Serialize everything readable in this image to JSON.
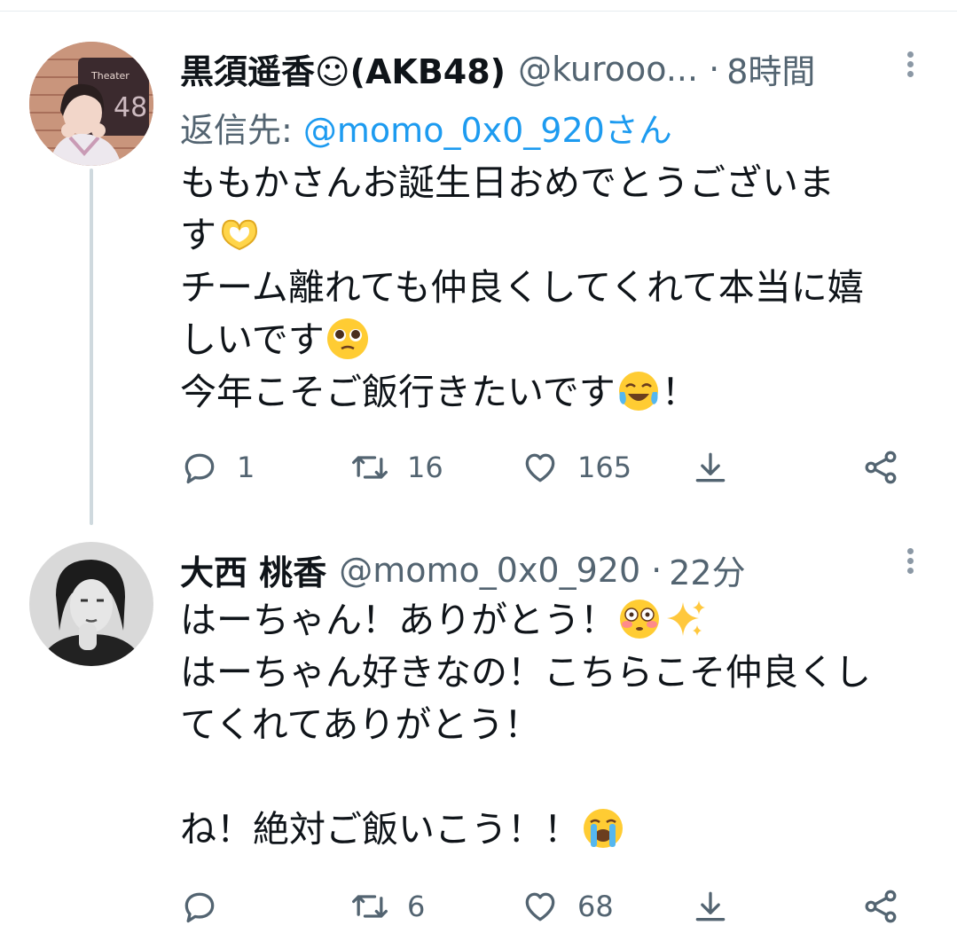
{
  "tweets": [
    {
      "name": "黒須遥香☺(AKB48)",
      "handle": "@kurooo...",
      "separator": "·",
      "time": "8時間",
      "reply_label": "返信先:",
      "reply_to": "@momo_0x0_920さん",
      "lines": [
        "ももかさんお誕生日おめでとうございま",
        "す",
        "チーム離れても仲良くしてくれて本当に嬉",
        "しいです",
        "今年こそご飯行きたいです",
        "！"
      ],
      "emoji": [
        "heart-hands-emoji",
        "pleading-face-emoji",
        "tears-of-joy-emoji"
      ],
      "counts": {
        "replies": "1",
        "retweets": "16",
        "likes": "165"
      }
    },
    {
      "name": "大西 桃香",
      "handle": "@momo_0x0_920",
      "separator": "·",
      "time": "22分",
      "lines": [
        "はーちゃん！ありがとう！",
        "はーちゃん好きなの！こちらこそ仲良くし",
        "てくれてありがとう！",
        "",
        "ね！絶対ご飯いこう！！"
      ],
      "emoji": [
        "flushed-face-emoji",
        "sparkles-emoji",
        "loudly-crying-face-emoji"
      ],
      "counts": {
        "replies": "",
        "retweets": "6",
        "likes": "68"
      }
    }
  ],
  "colors": {
    "text": "#0f1419",
    "secondary": "#536471",
    "link": "#1d9bf0",
    "thread": "#cfd9de"
  },
  "icons": [
    "reply-icon",
    "retweet-icon",
    "like-icon",
    "share-icon",
    "send-icon",
    "more-icon"
  ]
}
